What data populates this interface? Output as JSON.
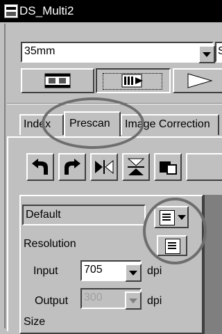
{
  "window": {
    "title": "DS_Multi2",
    "icon": "scanner-app-icon"
  },
  "film_type": {
    "value": "35mm",
    "next_value_fragment": "S",
    "options_visible": [
      "35mm"
    ]
  },
  "mode_buttons": [
    {
      "name": "filmstrip-mode",
      "icon": "filmstrip-icon",
      "pressed": false
    },
    {
      "name": "slide-mode",
      "icon": "slide-icon",
      "pressed": true
    },
    {
      "name": "play-mode",
      "icon": "play-icon",
      "pressed": false
    }
  ],
  "tabs": [
    {
      "label": "Index",
      "active": false
    },
    {
      "label": "Prescan",
      "active": true
    },
    {
      "label": "Image Correction",
      "active": false
    }
  ],
  "toolbar_icons": [
    "rotate-left-icon",
    "rotate-right-icon",
    "flip-horizontal-icon",
    "flip-vertical-icon",
    "crop-icon"
  ],
  "settings": {
    "value": "Default"
  },
  "resolution": {
    "label": "Resolution",
    "input_label": "Input",
    "input_value": "705",
    "input_unit": "dpi",
    "output_label": "Output",
    "output_value": "300",
    "output_unit": "dpi",
    "output_enabled": false
  },
  "size_label": "Size",
  "colors": {
    "ellipse": "#6e6e6e",
    "face": "#c0c0c0",
    "preview": "#7f7f7f"
  }
}
